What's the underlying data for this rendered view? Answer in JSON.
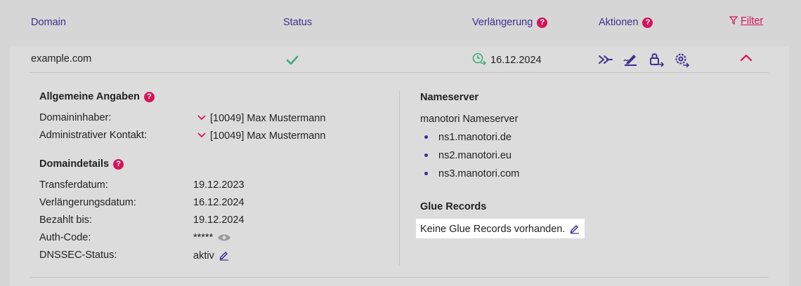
{
  "header": {
    "domain": "Domain",
    "status": "Status",
    "renewal": "Verlängerung",
    "actions": "Aktionen",
    "filter": "Filter"
  },
  "row": {
    "domain": "example.com",
    "renewal_date": "16.12.2024"
  },
  "general": {
    "title": "Allgemeine Angaben",
    "owner_label": "Domaininhaber:",
    "owner_value": "[10049] Max Mustermann",
    "admin_label": "Administrativer Kontakt:",
    "admin_value": "[10049] Max Mustermann"
  },
  "details": {
    "title": "Domaindetails",
    "transfer_label": "Transferdatum:",
    "transfer_value": "19.12.2023",
    "renewal_label": "Verlängerungsdatum:",
    "renewal_value": "16.12.2024",
    "paid_label": "Bezahlt bis:",
    "paid_value": "19.12.2024",
    "auth_label": "Auth-Code:",
    "auth_value": "*****",
    "dnssec_label": "DNSSEC-Status:",
    "dnssec_value": "aktiv"
  },
  "nameserver": {
    "title": "Nameserver",
    "provider": "manotori Nameserver",
    "servers": [
      "ns1.manotori.de",
      "ns2.manotori.eu",
      "ns3.manotori.com"
    ]
  },
  "glue": {
    "title": "Glue Records",
    "empty_text": "Keine Glue Records vorhanden."
  },
  "colors": {
    "accent": "#3d2f8f",
    "magenta": "#d4145a",
    "success": "#3daa7a",
    "background": "#d6d6d6"
  },
  "icons": {
    "status": "checkmark-icon",
    "renewal": "clock-renew-icon",
    "actions": [
      "transfer-icon",
      "signature-icon",
      "lock-transfer-icon",
      "settings-transfer-icon"
    ],
    "collapse": "chevron-up-icon",
    "filter": "funnel-icon",
    "help": "question-icon",
    "edit": "pencil-icon",
    "reveal": "eye-icon",
    "expand": "chevron-down-icon"
  }
}
